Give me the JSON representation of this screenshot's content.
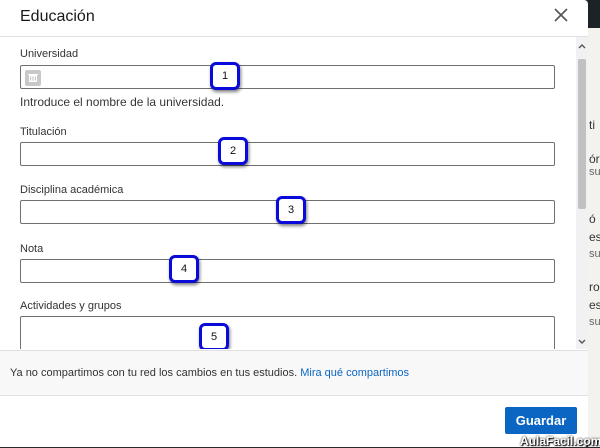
{
  "modal": {
    "title": "Educación",
    "close_icon": "close-icon"
  },
  "fields": {
    "university": {
      "label": "Universidad",
      "value": "",
      "hint": "Introduce el nombre de la universidad.",
      "icon": "building-icon"
    },
    "degree": {
      "label": "Titulación",
      "value": ""
    },
    "discipline": {
      "label": "Disciplina académica",
      "value": ""
    },
    "grade": {
      "label": "Nota",
      "value": ""
    },
    "activities": {
      "label": "Actividades y grupos",
      "value": ""
    }
  },
  "badges": [
    "1",
    "2",
    "3",
    "4",
    "5"
  ],
  "footer": {
    "note_text": "Ya no compartimos con tu red los cambios en tus estudios.",
    "note_link": "Mira qué compartimos"
  },
  "actions": {
    "save_label": "Guardar"
  },
  "background": {
    "fragments": [
      "ti",
      "ór",
      "su",
      "ó",
      "es",
      "su",
      "ro",
      "es",
      "su"
    ]
  },
  "watermark": "AulaFacil.com",
  "colors": {
    "accent": "#0a66c2",
    "badge_border": "#0a0ad9"
  }
}
